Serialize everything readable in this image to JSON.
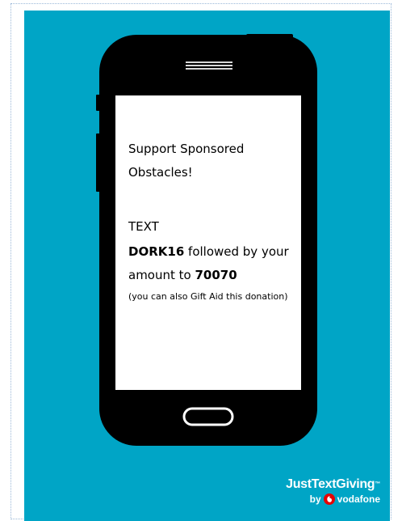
{
  "colors": {
    "poster_background": "#00a5c6",
    "phone_body": "#000000",
    "screen": "#ffffff",
    "vodafone_red": "#e60000"
  },
  "screen": {
    "heading": "Support Sponsored Obstacles!",
    "text_label": "TEXT",
    "code": "DORK16",
    "followed_by": " followed by your amount to ",
    "number": "70070",
    "note": "(you can also Gift Aid this donation)"
  },
  "brand": {
    "name": "JustTextGiving",
    "trademark": "™",
    "by": "by",
    "partner": "vodafone",
    "logo_icon": "vodafone-logo-icon"
  },
  "phone": {
    "speaker_icon": "speaker-grille-icon",
    "home_button_icon": "home-button-icon"
  }
}
